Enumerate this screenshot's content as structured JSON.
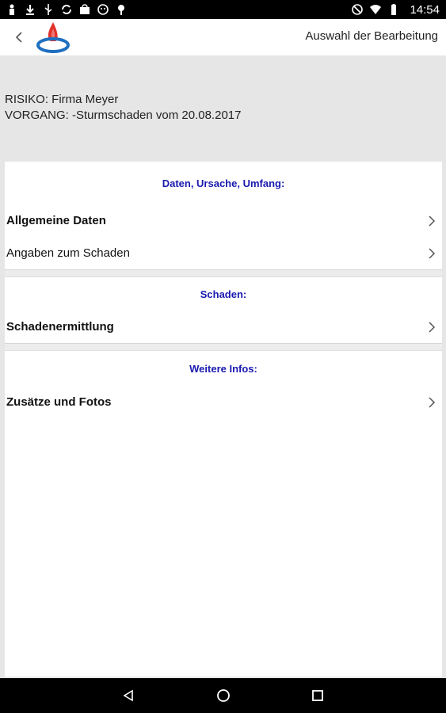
{
  "status_bar": {
    "left_icons": [
      "person-icon",
      "download-icon",
      "usb-icon",
      "sync-icon",
      "shopping-bag-icon",
      "face-icon",
      "location-pin-icon"
    ],
    "right_icons": [
      "do-not-disturb-icon",
      "wifi-icon",
      "battery-icon"
    ],
    "time": "14:54"
  },
  "app_bar": {
    "title": "Auswahl der Bearbeitung",
    "logo_colors": {
      "flame": "#e1322b",
      "ring": "#1f6fc0"
    }
  },
  "info": {
    "line1": "RISIKO: Firma Meyer",
    "line2": "VORGANG: -Sturmschaden vom 20.08.2017"
  },
  "sections": [
    {
      "header": "Daten, Ursache, Umfang:",
      "items": [
        {
          "label": "Allgemeine Daten",
          "bold": true
        },
        {
          "label": "Angaben zum Schaden",
          "bold": false
        }
      ]
    },
    {
      "header": "Schaden:",
      "items": [
        {
          "label": "Schadenermittlung",
          "bold": true
        }
      ]
    },
    {
      "header": "Weitere Infos:",
      "items": [
        {
          "label": "Zusätze und Fotos",
          "bold": true
        }
      ]
    }
  ],
  "nav_bar": {
    "buttons": [
      "back-triangle-icon",
      "home-circle-icon",
      "recents-square-icon"
    ]
  },
  "colors": {
    "section_header": "#1a1ab0",
    "background": "#e6e6e6"
  }
}
